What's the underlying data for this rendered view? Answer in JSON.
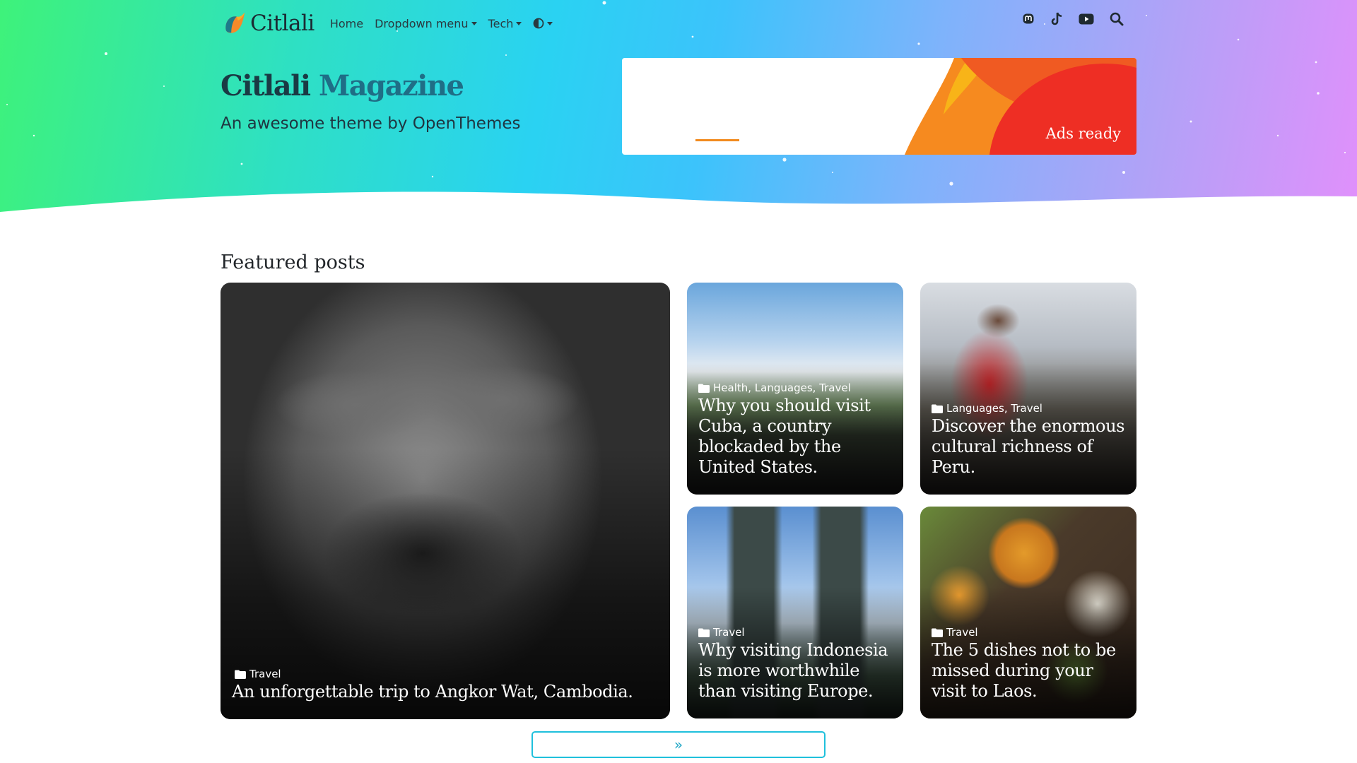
{
  "brand": {
    "name": "Citlali"
  },
  "nav": {
    "items": [
      {
        "label": "Home"
      },
      {
        "label": "Dropdown menu"
      },
      {
        "label": "Tech"
      }
    ],
    "theme_icon": "contrast-icon"
  },
  "social": [
    "mastodon-icon",
    "tiktok-icon",
    "youtube-icon",
    "search-icon"
  ],
  "hero": {
    "title_part1": "Citlali",
    "title_part2": "Magazine",
    "tagline": "An awesome theme by OpenThemes"
  },
  "ad": {
    "label": "Ads ready"
  },
  "featured": {
    "heading": "Featured posts",
    "posts": [
      {
        "category": "Travel",
        "title": "An unforgettable trip to Angkor Wat, Cambodia."
      },
      {
        "category": "Health, Languages, Travel",
        "title": "Why you should visit Cuba, a country blockaded by the United States."
      },
      {
        "category": "Languages, Travel",
        "title": "Discover the enormous cultural richness of Peru."
      },
      {
        "category": "Travel",
        "title": "Why visiting Indonesia is more worthwhile than visiting Europe."
      },
      {
        "category": "Travel",
        "title": "The 5 dishes not to be missed during your visit to Laos."
      }
    ]
  },
  "more_button": {
    "icon": "double-chevron-right-icon",
    "glyph": "»"
  },
  "colors": {
    "accent": "#1fc0dc",
    "ad_orange": "#f7931e",
    "ad_red": "#ee2e24"
  }
}
